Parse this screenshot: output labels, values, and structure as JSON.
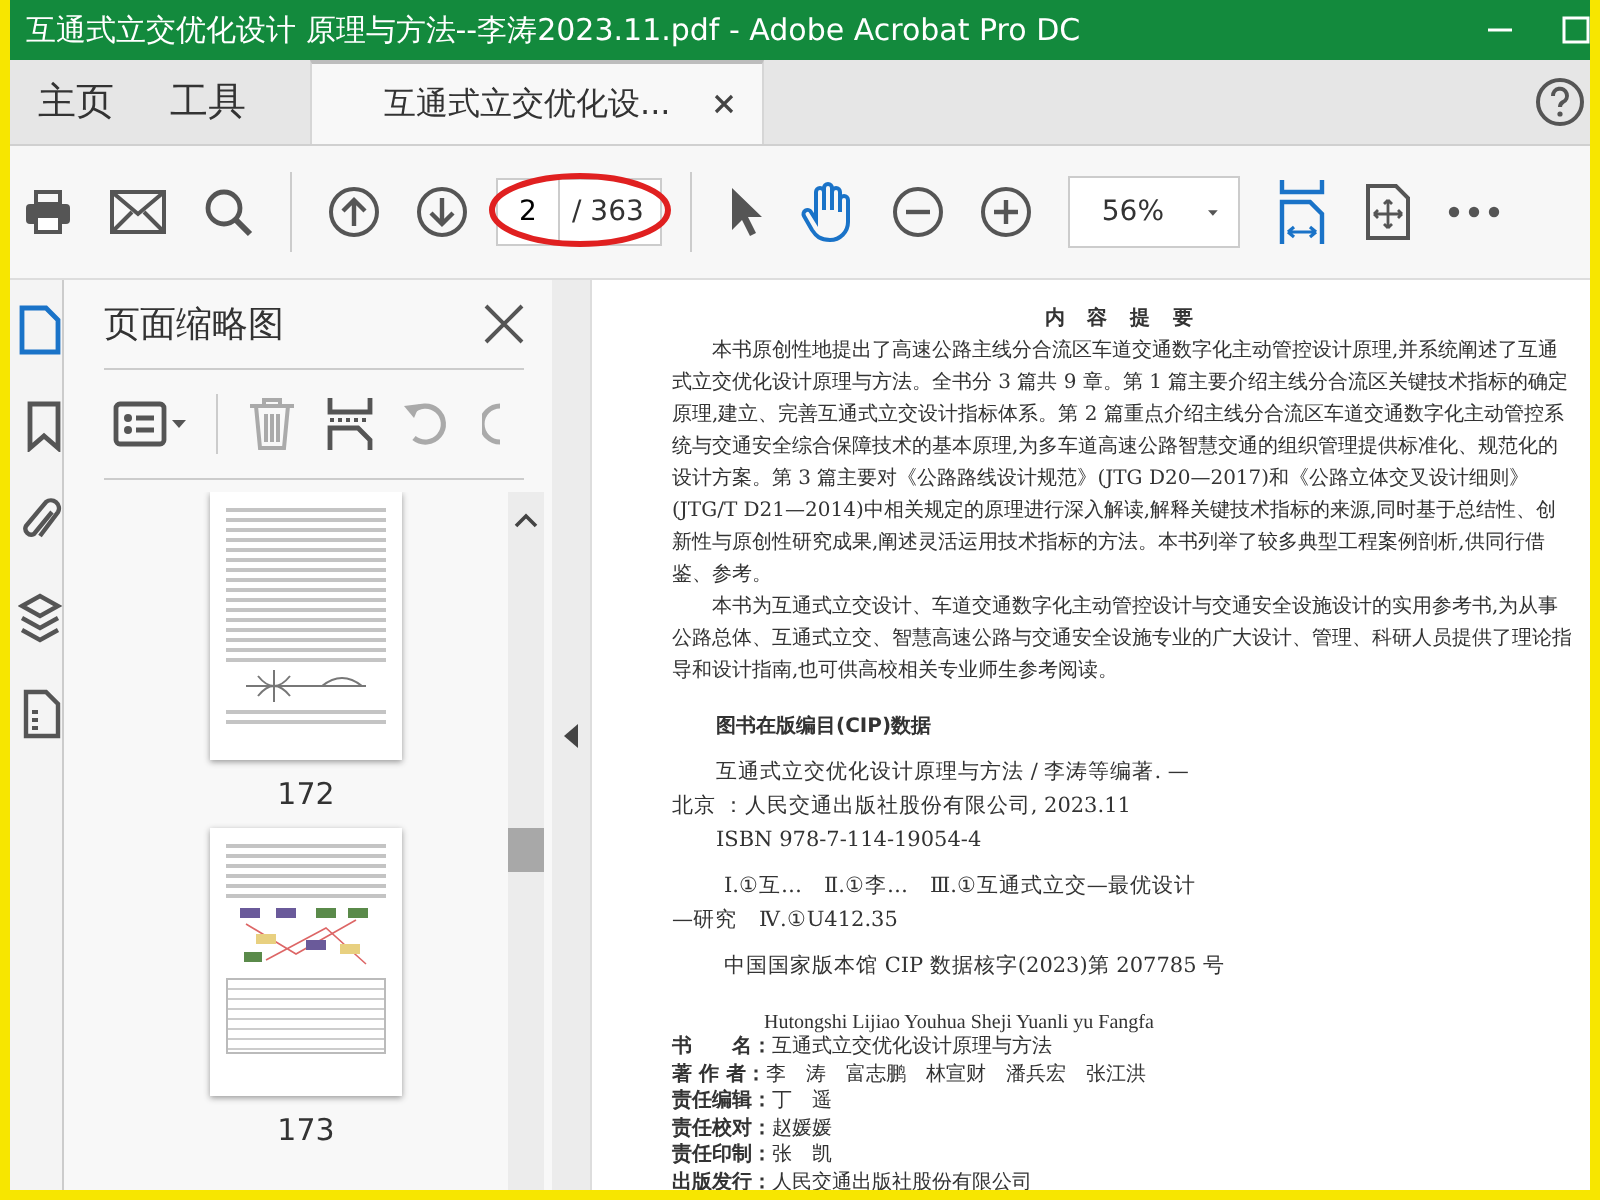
{
  "window": {
    "title": "互通式立交优化设计  原理与方法--李涛2023.11.pdf - Adobe Acrobat Pro DC"
  },
  "nav_tabs": [
    {
      "label": "主页",
      "selected": false
    },
    {
      "label": "工具",
      "selected": false
    }
  ],
  "document_tab": {
    "label": "互通式立交优化设...",
    "selected": true
  },
  "toolbar": {
    "page_number": "2",
    "page_total": "/ 363",
    "zoom": "56%",
    "hand_tool_selected": true
  },
  "rail": [
    {
      "kind": "pages",
      "selected": true
    },
    {
      "kind": "bookmarks",
      "selected": false
    },
    {
      "kind": "attachments",
      "selected": false
    },
    {
      "kind": "layers",
      "selected": false
    },
    {
      "kind": "content",
      "selected": false
    }
  ],
  "thumbnails_panel": {
    "title": "页面缩略图",
    "thumbnails": [
      {
        "label": "172",
        "kind": "text-figure"
      },
      {
        "label": "173",
        "kind": "chart-table"
      }
    ]
  },
  "document": {
    "heading": "内 容 提 要",
    "paragraphs": [
      "本书原创性地提出了高速公路主线分合流区车道交通数字化主动管控设计原理,并系统阐述了互通式立交优化设计原理与方法。全书分 3 篇共 9 章。第 1 篇主要介绍主线分合流区关键技术指标的确定原理,建立、完善互通式立交设计指标体系。第 2 篇重点介绍主线分合流区车道交通数字化主动管控系统与交通安全综合保障技术的基本原理,为多车道高速公路智慧交通的组织管理提供标准化、规范化的设计方案。第 3 篇主要对《公路路线设计规范》(JTG D20—2017)和《公路立体交叉设计细则》(JTG/T D21—2014)中相关规定的原理进行深入解读,解释关键技术指标的来源,同时基于总结性、创新性与原创性研究成果,阐述灵活运用技术指标的方法。本书列举了较多典型工程案例剖析,供同行借鉴、参考。",
      "本书为互通式立交设计、车道交通数字化主动管控设计与交通安全设施设计的实用参考书,为从事公路总体、互通式立交、智慧高速公路与交通安全设施专业的广大设计、管理、科研人员提供了理论指导和设计指南,也可供高校相关专业师生参考阅读。"
    ],
    "cip_heading": "图书在版编目(CIP)数据",
    "cip_lines": [
      {
        "text": "互通式立交优化设计原理与方法 / 李涛等编著. —",
        "kind": "indent"
      },
      {
        "text": "北京 ：人民交通出版社股份有限公司, 2023.11",
        "kind": "hang"
      },
      {
        "text": "ISBN 978-7-114-19054-4",
        "kind": "indent"
      },
      {
        "text": "Ⅰ.①互…　Ⅱ.①李…　Ⅲ.①互通式立交—最优设计",
        "kind": "gap"
      },
      {
        "text": "—研究　Ⅳ.①U412.35",
        "kind": "hang"
      },
      {
        "text": "中国国家版本馆 CIP 数据核字(2023)第 207785 号",
        "kind": "gap"
      }
    ],
    "pinyin_title": "Hutongshi Lijiao Youhua Sheji Yuanli yu Fangfa",
    "credits": [
      {
        "label": "书　　名：",
        "value": "互通式立交优化设计原理与方法"
      },
      {
        "label": "著 作 者：",
        "value": "李　涛　富志鹏　林宣财　潘兵宏　张江洪"
      },
      {
        "label": "责任编辑：",
        "value": "丁　遥"
      },
      {
        "label": "责任校对：",
        "value": "赵媛媛"
      },
      {
        "label": "责任印制：",
        "value": "张　凯"
      },
      {
        "label": "出版发行：",
        "value": "人民交通出版社股份有限公司"
      }
    ]
  }
}
